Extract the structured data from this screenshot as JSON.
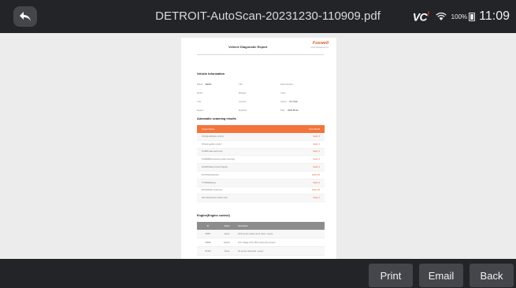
{
  "topbar": {
    "title": "DETROIT-AutoScan-20231230-110909.pdf",
    "vci_label": "VC",
    "vci_mark": "!",
    "battery_pct": "100%",
    "time": "11:09",
    "back_icon": "back-arrow-icon",
    "wifi_icon": "wifi-icon",
    "battery_icon": "battery-icon"
  },
  "document": {
    "title": "Vehicle Diagnostic Report",
    "brand": "Foxwell",
    "brand_sub": "www.foxwelltech.us",
    "vehicle_info_title": "Vehicle Information",
    "info_rows": [
      [
        {
          "k": "Brand:",
          "v": "DEMO"
        },
        {
          "k": "VIN:",
          "v": ""
        },
        {
          "k": "Plate Number:",
          "v": ""
        }
      ],
      [
        {
          "k": "Model:",
          "v": ""
        },
        {
          "k": "Mileage:",
          "v": ""
        },
        {
          "k": "Color:",
          "v": ""
        }
      ],
      [
        {
          "k": "Year:",
          "v": ""
        },
        {
          "k": "Country:",
          "v": ""
        },
        {
          "k": "Owner:",
          "v": "Pro Scan"
        }
      ],
      [
        {
          "k": "Engine:",
          "v": ""
        },
        {
          "k": "Engineer:",
          "v": ""
        },
        {
          "k": "Date:",
          "v": "2023-08-24"
        }
      ]
    ],
    "scan_title": "Automatic scanning results",
    "scan_header": {
      "system": "System Name",
      "result": "Scan Result"
    },
    "scan_rows": [
      {
        "system": "01 Engine(Engine control)",
        "result": "Fault | 3"
      },
      {
        "system": "02 Auto gearbox control",
        "result": "Fault | 3"
      },
      {
        "system": "03 ABS brake electronics",
        "result": "Fault | 3"
      },
      {
        "system": "04 ESM(Multi-scheme system steering)",
        "result": "Fault | 3"
      },
      {
        "system": "05 ESP(Safety control chassis)",
        "result": "Fault | 2"
      },
      {
        "system": "06 CPC(Powertrain)",
        "result": "Fault | 20"
      },
      {
        "system": "07 MCM(Engine)",
        "result": "Fault | 8"
      },
      {
        "system": "08 ACM(After treatment)",
        "result": "Fault | 40"
      },
      {
        "system": "09 ICU(Instrument cluster unit)",
        "result": "Fault | 3"
      }
    ],
    "codes_title": "Engine(Engine control)",
    "codes_header": {
      "code": "ID",
      "status": "Status",
      "desc": "Description"
    },
    "code_rows": [
      {
        "code": "P0087",
        "status": "Active",
        "desc": "NOX sensor (outlet) circuit check - sensor"
      },
      {
        "code": "P2BAE",
        "status": "Inactive",
        "desc": "Poor voltage at the NOX sensor (pre-sensor)"
      },
      {
        "code": "P2146",
        "status": "Active",
        "desc": "O2 sensor circuit fault - sensor"
      }
    ]
  },
  "bottombar": {
    "print_label": "Print",
    "email_label": "Email",
    "back_label": "Back"
  }
}
